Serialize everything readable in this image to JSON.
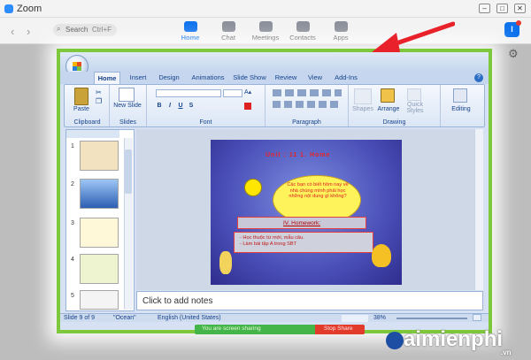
{
  "window": {
    "title": "Zoom",
    "controls": [
      "–",
      "□",
      "✕"
    ]
  },
  "zoom_nav": {
    "search_label": "Search",
    "search_shortcut": "Ctrl+F",
    "tabs": [
      {
        "label": "Home",
        "icon": "home-icon",
        "active": true
      },
      {
        "label": "Chat",
        "icon": "chat-icon",
        "active": false
      },
      {
        "label": "Meetings",
        "icon": "meetings-icon",
        "active": false
      },
      {
        "label": "Contacts",
        "icon": "contacts-icon",
        "active": false
      },
      {
        "label": "Apps",
        "icon": "apps-icon",
        "active": false
      }
    ],
    "avatar_letter": "l"
  },
  "ppt": {
    "ribbon_tabs": [
      "Home",
      "Insert",
      "Design",
      "Animations",
      "Slide Show",
      "Review",
      "View",
      "Add-Ins"
    ],
    "groups": {
      "clipboard": "Clipboard",
      "slides": "Slides",
      "font": "Font",
      "paragraph": "Paragraph",
      "drawing": "Drawing",
      "editing": "Editing"
    },
    "buttons": {
      "paste": "Paste",
      "new_slide": "New Slide",
      "shapes": "Shapes",
      "arrange": "Arrange",
      "quick_styles": "Quick Styles"
    },
    "fmt_buttons": [
      "B",
      "I",
      "U",
      "S"
    ],
    "slide_numbers": [
      "1",
      "2",
      "3",
      "4",
      "5"
    ],
    "notes_placeholder": "Click to add notes",
    "status": {
      "slide": "Slide 9 of 9",
      "theme": "\"Ocean\"",
      "language": "English (United States)",
      "zoom": "38%"
    },
    "slide": {
      "header": "Unit : 11  1.  Home",
      "cloud_text": "Các bạn có biết hôm nay về nhà chúng mình phải học những nội dung gì không?",
      "homework_title": "IV. Homework:",
      "homework_lines": [
        "- Học thuộc từ mới, mẫu câu.",
        "- Làm bài tập  A trong SBT"
      ]
    }
  },
  "share_bar": {
    "sharing": "You are screen sharing",
    "stop": "Stop Share"
  },
  "watermark": {
    "brand": "aimienphi",
    "domain": ".vn"
  },
  "colors": {
    "zoom_blue": "#0e72ed",
    "share_border": "#7dc93b",
    "arrow": "#e8212a",
    "stop": "#e23a2b"
  }
}
